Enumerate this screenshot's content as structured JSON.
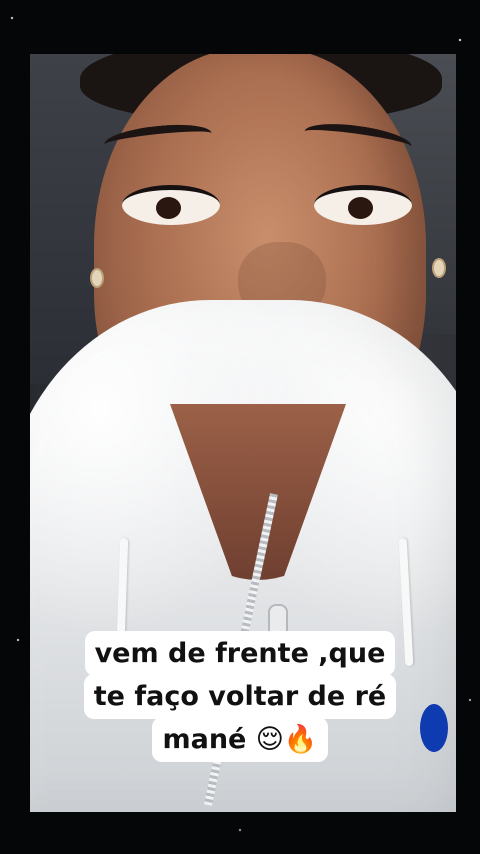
{
  "caption": {
    "lines": [
      "vem de frente ,que",
      "te faço voltar de ré",
      "mané 😌🔥"
    ]
  }
}
